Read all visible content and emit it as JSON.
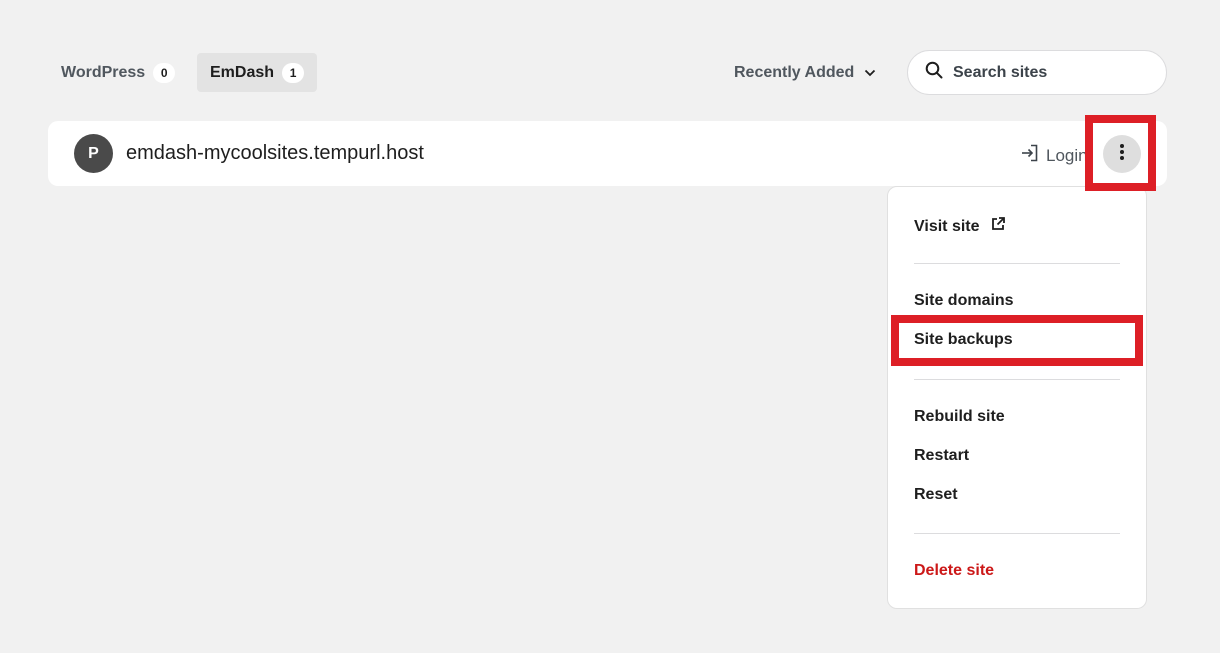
{
  "tabs": [
    {
      "label": "WordPress",
      "count": "0",
      "active": false
    },
    {
      "label": "EmDash",
      "count": "1",
      "active": true
    }
  ],
  "sort": {
    "label": "Recently Added",
    "icon": "chevron-down-icon"
  },
  "search": {
    "placeholder": "Search sites",
    "value": "",
    "icon": "search-icon"
  },
  "site": {
    "avatar_letter": "P",
    "url": "emdash-mycoolsites.tempurl.host",
    "login_label": "Login",
    "login_icon": "login-arrow-icon",
    "more_icon": "more-vertical-icon"
  },
  "menu": {
    "visit_site": "Visit site",
    "visit_icon": "external-link-icon",
    "site_domains": "Site domains",
    "site_backups": "Site backups",
    "rebuild_site": "Rebuild site",
    "restart": "Restart",
    "reset": "Reset",
    "delete_site": "Delete site"
  },
  "colors": {
    "background": "#f1f1f1",
    "card": "#ffffff",
    "danger": "#cc1818",
    "highlight": "#dd1f26",
    "avatar": "#4a4a4a"
  }
}
